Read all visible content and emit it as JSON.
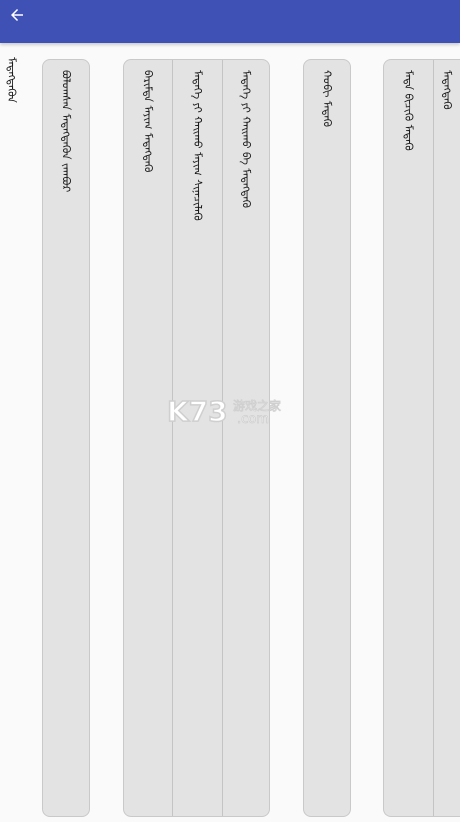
{
  "header": {
    "back_icon": "arrow-left-icon",
    "background": "#3f51b5"
  },
  "section": {
    "title": "ᠮᠡᠳᠡᠭᠳᠡᠬᠦᠨ"
  },
  "cards": [
    {
      "items": [
        "ᠪᠣᠯᠣᠭᠰᠠᠨ ᠮᠡᠳᠡᠭᠳᠡᠬᠦᠨ ᠵᠠᠭᠪᠤᠷ"
      ]
    },
    {
      "items": [
        "ᠪᠠᠷᠢᠮᠲᠠ ᠮᠠᠶᠢᠭ ᠮᠡᠳᠡᠭᠳᠡᠬᠦ",
        "ᠮᠡᠳᠡᠭᠡ ᠶᠢ ᠬᠠᠢᠬᠤ ᠮᠠᠶᠢᠭ ᠰᠢᠨᠡᠴᠢᠯᠡᠬᠦ",
        "ᠮᠡᠳᠡᠭᠡ ᠶᠢ ᠬᠠᠢᠬᠤ ᠪᠡ ᠮᠡᠳᠡᠭᠳᠡᠬᠦ"
      ]
    },
    {
      "items": [
        "ᠬᠣᠪᠢ ᠮᠡᠳᠡᠬᠦ"
      ]
    },
    {
      "items": [
        "ᠮᠡᠳᠡ ᠪᠢᠴᠢᠬᠦ ᠮᠡᠳᠡᠬᠦ",
        "ᠮᠡᠳᠡᠭᠳᠡᠬᠦ"
      ]
    }
  ],
  "watermark": {
    "logo": "K73",
    "text_cn": "游戏之家",
    "domain": ".com"
  }
}
